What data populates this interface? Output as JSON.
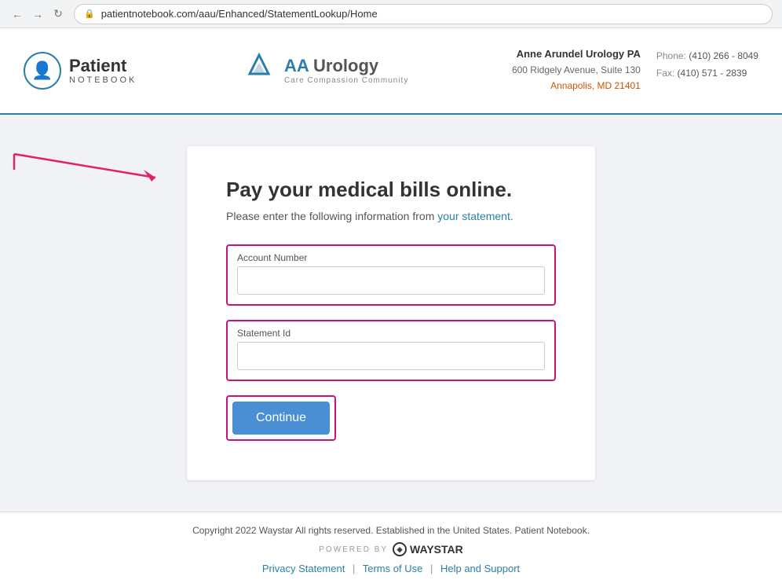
{
  "browser": {
    "url": "patientnotebook.com/aau/Enhanced/StatementLookup/Home"
  },
  "header": {
    "patient_notebook_label": "Patient",
    "patient_notebook_sub": "NOTEBOOK",
    "clinic_name": "AA·Urology",
    "clinic_tagline": "Care Compassion Community",
    "clinic_full_name": "Anne Arundel Urology PA",
    "clinic_address": "600 Ridgely Avenue, Suite 130",
    "clinic_city": "Annapolis, MD 21401",
    "phone_label": "Phone:",
    "phone_number": "(410) 266 - 8049",
    "fax_label": "Fax:",
    "fax_number": "(410) 571 - 2839"
  },
  "form": {
    "title": "Pay your medical bills online.",
    "subtitle": "Please enter the following information from",
    "subtitle_link": "your statement.",
    "account_number_label": "Account Number",
    "account_number_placeholder": "",
    "statement_id_label": "Statement Id",
    "statement_id_placeholder": "",
    "continue_button": "Continue"
  },
  "footer": {
    "copyright": "Copyright 2022 Waystar All rights reserved. Established in the United States. Patient Notebook.",
    "powered_by": "POWERED BY",
    "waystar_name": "WAYSTAR",
    "privacy_link": "Privacy Statement",
    "terms_link": "Terms of Use",
    "help_link": "Help and Support"
  }
}
